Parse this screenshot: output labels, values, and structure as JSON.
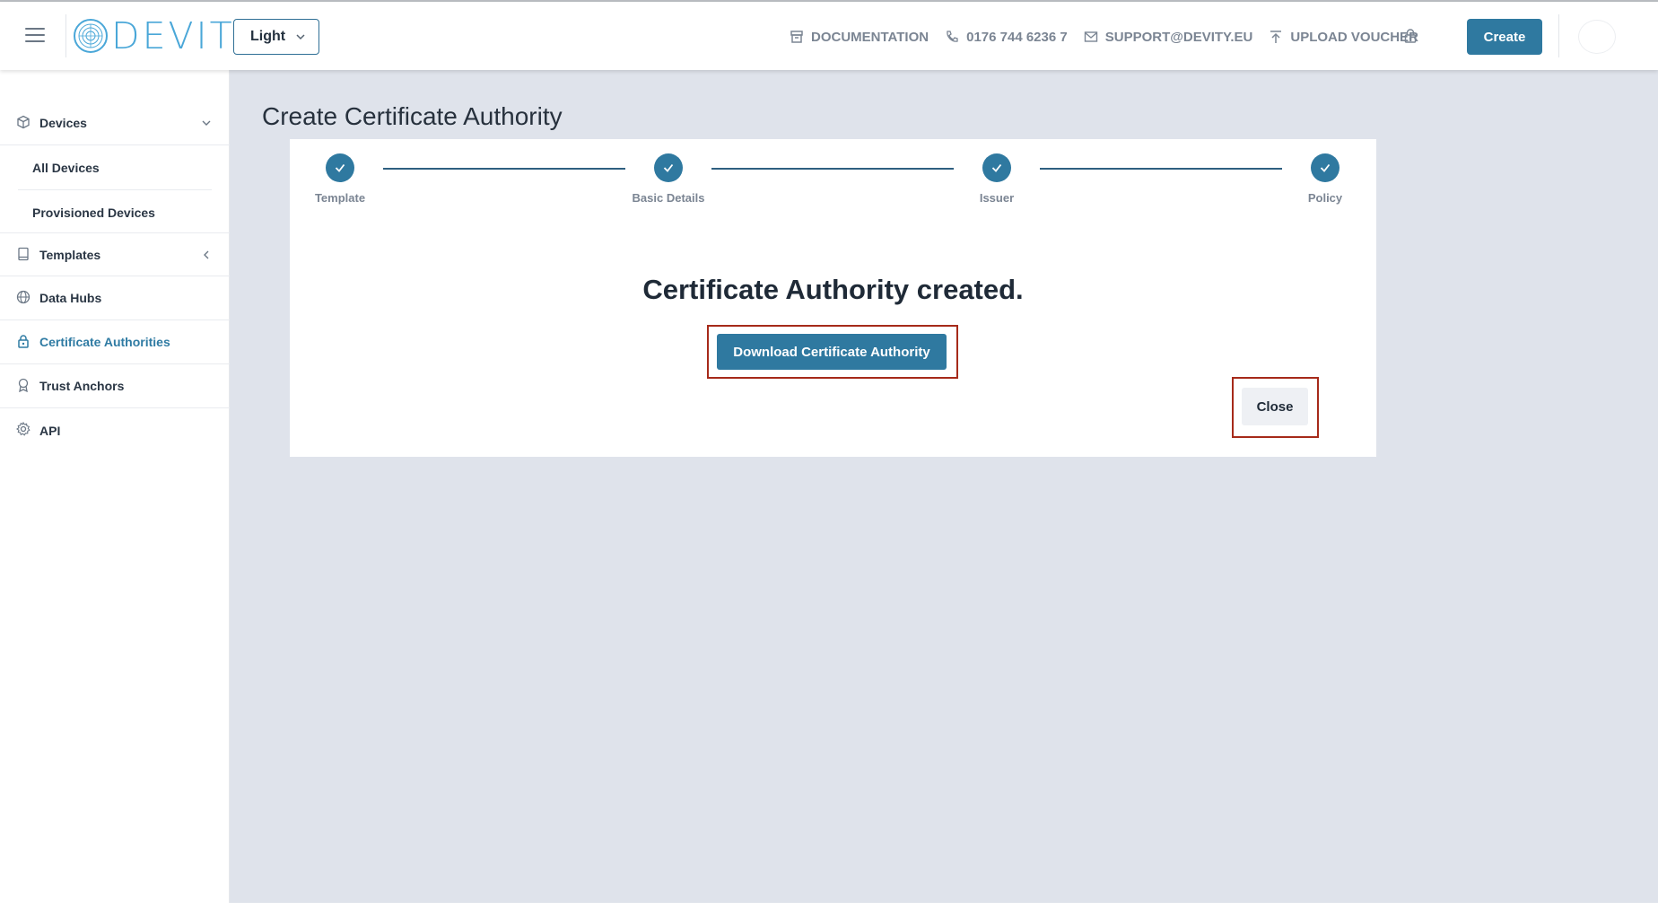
{
  "header": {
    "logo_text": "DEVITY",
    "theme_value": "Light",
    "links": {
      "documentation": "DOCUMENTATION",
      "phone": "0176 744 6236 7",
      "email": "SUPPORT@DEVITY.EU",
      "upload": "UPLOAD VOUCHER"
    },
    "create_label": "Create"
  },
  "sidebar": {
    "devices": "Devices",
    "all_devices": "All Devices",
    "provisioned_devices": "Provisioned Devices",
    "templates": "Templates",
    "data_hubs": "Data Hubs",
    "certificate_authorities": "Certificate Authorities",
    "trust_anchors": "Trust Anchors",
    "api": "API"
  },
  "main": {
    "title": "Create Certificate Authority",
    "steps": [
      "Template",
      "Basic Details",
      "Issuer",
      "Policy"
    ],
    "created_message": "Certificate Authority created.",
    "download_label": "Download Certificate Authority",
    "close_label": "Close"
  },
  "colors": {
    "accent": "#2f79a0",
    "highlight_border": "#a62a1a",
    "main_bg": "#dfe3eb",
    "logo": "#4aa7d8"
  }
}
